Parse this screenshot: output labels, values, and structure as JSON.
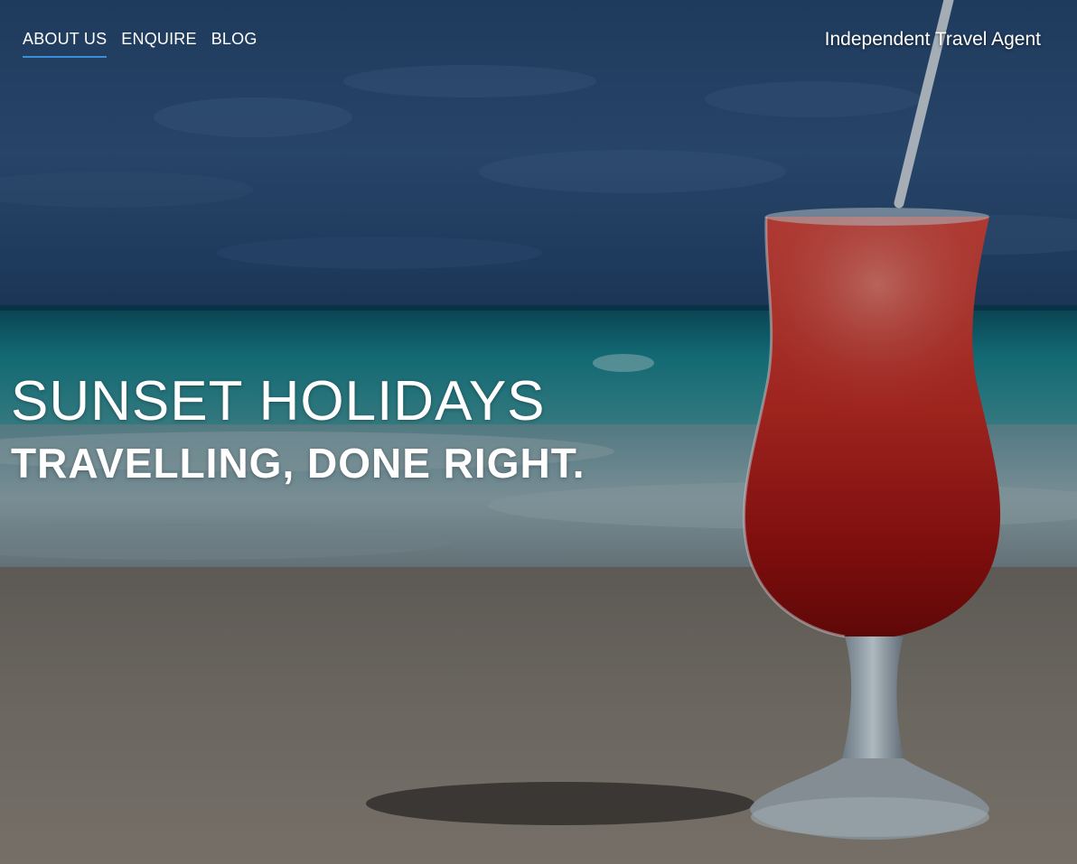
{
  "nav": {
    "items": [
      {
        "label": "ABOUT US",
        "active": true
      },
      {
        "label": "ENQUIRE",
        "active": false
      },
      {
        "label": "BLOG",
        "active": false
      }
    ],
    "accent_color": "#3a8fd8"
  },
  "header": {
    "tagline": "Independent Travel Agent"
  },
  "hero": {
    "title": "SUNSET HOLIDAYS",
    "subtitle": "TRAVELLING, DONE RIGHT.",
    "background_image": "beach-cocktail-photo"
  }
}
